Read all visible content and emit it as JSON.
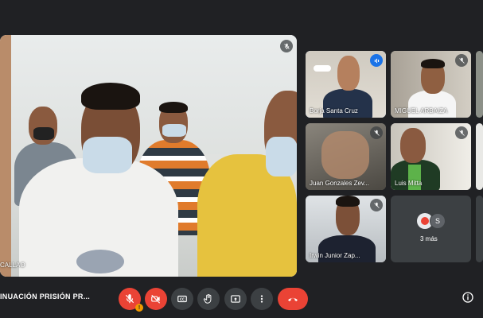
{
  "main": {
    "label": "CALLAO"
  },
  "participants": [
    {
      "name": "Borja Santa Cruz",
      "speaking": true
    },
    {
      "name": "MIGUEL ARBAIZA"
    },
    {
      "name": "Juan Gonzales Zev..."
    },
    {
      "name": "Luis Mitta"
    },
    {
      "name": "Irwin Junior Zap..."
    }
  ],
  "more": {
    "label": "3 más",
    "avatars": [
      {
        "initial": "",
        "color": "#e8eaed"
      },
      {
        "initial": "S",
        "color": "#5f6368"
      }
    ]
  },
  "meeting": {
    "title": "INUACIÓN PRISIÓN PR..."
  },
  "controls": {
    "mic": "mic-off-icon",
    "camera": "camera-off-icon",
    "captions": "CC",
    "raise_hand": "hand-icon",
    "present": "present-icon",
    "more_options": "more-icon",
    "end_call": "end-call-icon",
    "info": "info-icon",
    "alert_badge": "!"
  },
  "colors": {
    "background": "#202124",
    "danger": "#ea4335",
    "control": "#3c4043",
    "active_speaker": "#1a73e8"
  }
}
